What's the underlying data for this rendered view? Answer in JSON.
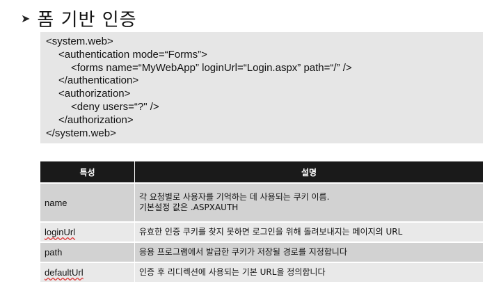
{
  "slide": {
    "bullet_icon": "arrow-bullet-icon",
    "title": "폼 기반 인증"
  },
  "code": {
    "lines": [
      "<system.web>",
      "<authentication mode=“Forms”>",
      "<forms name=“MyWebApp” loginUrl=“Login.aspx” path=“/” />",
      "</authentication>",
      "<authorization>",
      "<deny users=“?\" />",
      "</authorization>",
      "</system.web>"
    ]
  },
  "table": {
    "headers": [
      "특성",
      "설명"
    ],
    "rows": [
      {
        "name": "name",
        "desc": [
          "각 요청별로 사용자를 기억하는 데 사용되는 쿠키 이름.",
          "기본설정 값은 .ASPXAUTH"
        ]
      },
      {
        "name": "loginUrl",
        "desc": [
          "유효한 인증 쿠키를 찾지 못하면 로그인을 위해 돌려보내지는 페이지의 URL"
        ]
      },
      {
        "name": "path",
        "desc": [
          "응용 프로그램에서 발급한 쿠키가 저장될 경로를 지정합니다"
        ]
      },
      {
        "name": "defaultUrl",
        "desc": [
          "인증 후 리디렉션에 사용되는 기본 URL을 정의합니다"
        ]
      }
    ]
  }
}
